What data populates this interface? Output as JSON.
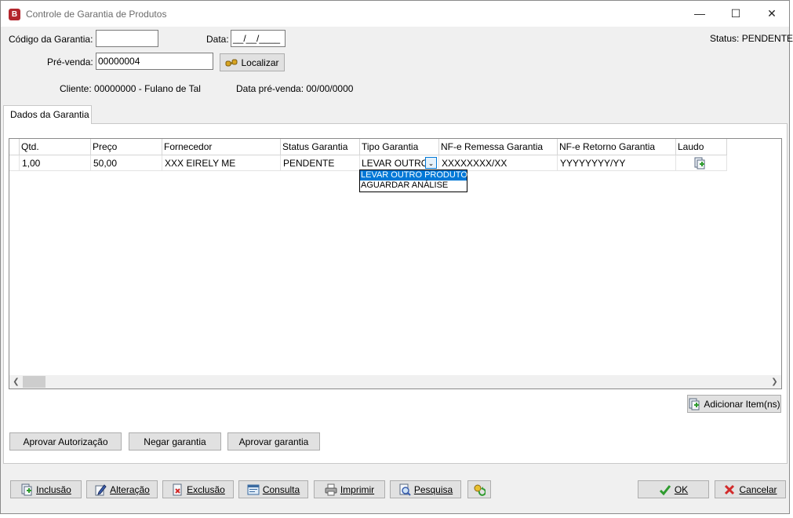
{
  "window": {
    "title": "Controle de Garantia de Produtos",
    "app_icon_letter": "B",
    "minimize": "—",
    "maximize": "☐",
    "close": "✕"
  },
  "form": {
    "codigo_label": "Código da Garantia:",
    "codigo_value": "",
    "data_label": "Data:",
    "data_value": "__/__/____",
    "status_text": "Status: PENDENTE",
    "prevenda_label": "Pré-venda:",
    "prevenda_value": "00000004",
    "localizar_label": "Localizar",
    "cliente_text": "Cliente: 00000000 - Fulano de Tal",
    "data_prevenda_text": "Data pré-venda: 00/00/0000"
  },
  "tab": {
    "label": "Dados da Garantia"
  },
  "grid": {
    "headers": [
      "Qtd.",
      "Preço",
      "Fornecedor",
      "Status Garantia",
      "Tipo Garantia",
      "NF-e Remessa Garantia",
      "NF-e Retorno Garantia",
      "Laudo"
    ],
    "row": {
      "qtd": "1,00",
      "preco": "50,00",
      "fornecedor": "XXX EIRELY ME",
      "status": "PENDENTE",
      "tipo": "LEVAR OUTRO",
      "nfe_remessa": "XXXXXXXX/XX",
      "nfe_retorno": "YYYYYYYY/YY"
    },
    "dropdown_options": [
      "LEVAR OUTRO PRODUTO",
      "AGUARDAR ANÁLISE"
    ],
    "selected_option": "LEVAR OUTRO PRODUTO"
  },
  "buttons": {
    "adicionar_item": "Adicionar Item(ns)",
    "aprovar_autorizacao": "Aprovar Autorização",
    "negar_garantia": "Negar garantia",
    "aprovar_garantia": "Aprovar garantia",
    "inclusao": "Inclusão",
    "alteracao": "Alteração",
    "exclusao": "Exclusão",
    "consulta": "Consulta",
    "imprimir": "Imprimir",
    "pesquisa": "Pesquisa",
    "ok": "OK",
    "cancelar": "Cancelar"
  },
  "colors": {
    "app_icon": "#b3262d",
    "selection": "#0078d7",
    "ok_check": "#2e9b2e",
    "cancel_x": "#d22a2a"
  }
}
